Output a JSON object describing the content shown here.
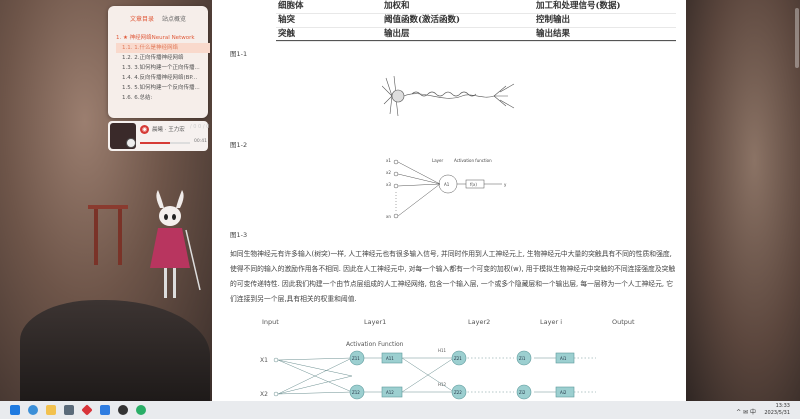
{
  "toc": {
    "tabs": [
      "文章目录",
      "站点概览"
    ],
    "items": [
      {
        "label": "1. ★ 神经网络Neural Network",
        "level": 1
      },
      {
        "label": "1.1. 1.什么是神经网络",
        "level": 2
      },
      {
        "label": "1.2. 2.正向传播神经网络",
        "level": 2
      },
      {
        "label": "1.3. 3.如何构建一个正向传播...",
        "level": 2
      },
      {
        "label": "1.4. 4.反向传播神经网络(BP...",
        "level": 2
      },
      {
        "label": "1.5. 5.如何构建一个反向传播...",
        "level": 2
      },
      {
        "label": "1.6. 6.总结:",
        "level": 2
      }
    ]
  },
  "player": {
    "song": "晨曦 · 王力宏",
    "time": "00:41",
    "progress": 0.6,
    "decor": "/ 0 0 / 0"
  },
  "table": {
    "rows": [
      [
        "细胞体",
        "加权和",
        "加工和处理信号(数据)"
      ],
      [
        "轴突",
        "阈值函数(激活函数)",
        "控制输出"
      ],
      [
        "突触",
        "输出层",
        "输出结果"
      ]
    ]
  },
  "figures": {
    "cap1": "图1-1",
    "cap2": "图1-2",
    "cap3": "图1-3",
    "fig2": {
      "layer_label": "Layer",
      "act_label": "Activation function",
      "inputs": [
        "x1",
        "x2",
        "x3",
        "xn"
      ],
      "node": "A1",
      "func": "f(x)",
      "out": "y"
    },
    "fig3": {
      "headers": [
        "Input",
        "Layer1",
        "Layer2",
        "Layer i",
        "Output"
      ],
      "activation": "Activation Function",
      "inputs": [
        "X1",
        "X2"
      ],
      "nodes": [
        "Z11",
        "A11",
        "Z21",
        "Zi1",
        "Ai1",
        "Z12",
        "A12",
        "Z22",
        "Zi2",
        "Ai2"
      ],
      "edge_labels": [
        "H11",
        "H12"
      ]
    }
  },
  "paragraph": "如同生物神经元有许多输入(树突)一样, 人工神经元也有很多输入信号, 并同时作用到人工神经元上, 生物神经元中大量的突触具有不同的性质和强度, 使得不同的输入的激励作用各不相同. 因此在人工神经元中, 对每一个输入都有一个可变的加权(w), 用于模拟生物神经元中突触的不同连接强度及突触的可变传递特性. 因此我们构建一个由节点层组成的人工神经网络, 包含一个输入层, 一个或多个隐藏层和一个输出层, 每一层称为一个人工神经元, 它们连接到另一个层,具有相关的权重和阈值.",
  "taskbar": {
    "time": "13:33",
    "date": "2023/5/31",
    "tray": "^ ✉ 中"
  },
  "colors": {
    "accent": "#e05a3a",
    "node_fill": "#9ccfd0",
    "node_stroke": "#5e9a9c",
    "taskbar": "#e9ebee"
  }
}
